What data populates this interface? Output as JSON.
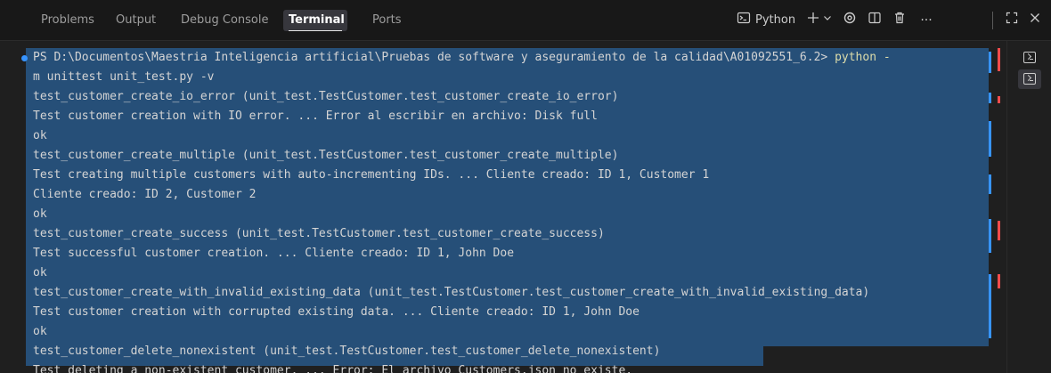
{
  "tabs": [
    {
      "label": "Problems",
      "active": false
    },
    {
      "label": "Output",
      "active": false
    },
    {
      "label": "Debug Console",
      "active": false
    },
    {
      "label": "Terminal",
      "active": true
    },
    {
      "label": "Ports",
      "active": false
    }
  ],
  "toolbar": {
    "shell_label": "Python",
    "icons": [
      "terminal-icon",
      "plus-icon",
      "chevron-down-icon",
      "copilot-icon",
      "split-icon",
      "trash-icon",
      "more-icon",
      "maximize-icon",
      "close-icon"
    ]
  },
  "terminal": {
    "lines": [
      {
        "text": "PS D:\\Documentos\\Maestria Inteligencia artificial\\Pruebas de software y aseguramiento de la calidad\\A01092551_6.2> ",
        "highlight": "python -"
      },
      {
        "text": "m unittest unit_test.py -v"
      },
      {
        "text": "test_customer_create_io_error (unit_test.TestCustomer.test_customer_create_io_error)"
      },
      {
        "text": "Test customer creation with IO error. ... Error al escribir en archivo: Disk full"
      },
      {
        "text": "ok"
      },
      {
        "text": "test_customer_create_multiple (unit_test.TestCustomer.test_customer_create_multiple)"
      },
      {
        "text": "Test creating multiple customers with auto-incrementing IDs. ... Cliente creado: ID 1, Customer 1"
      },
      {
        "text": "Cliente creado: ID 2, Customer 2"
      },
      {
        "text": "ok"
      },
      {
        "text": "test_customer_create_success (unit_test.TestCustomer.test_customer_create_success)"
      },
      {
        "text": "Test successful customer creation. ... Cliente creado: ID 1, John Doe"
      },
      {
        "text": "ok"
      },
      {
        "text": "test_customer_create_with_invalid_existing_data (unit_test.TestCustomer.test_customer_create_with_invalid_existing_data)"
      },
      {
        "text": "Test customer creation with corrupted existing data. ... Cliente creado: ID 1, John Doe"
      },
      {
        "text": "ok"
      },
      {
        "text": "test_customer_delete_nonexistent (unit_test.TestCustomer.test_customer_delete_nonexistent)"
      },
      {
        "text": "Test deleting a non-existent customer. ... Error: El archivo Customers.json no existe."
      }
    ]
  },
  "side_terminals": [
    "terminal-icon",
    "terminal-icon"
  ],
  "colors": {
    "selection": "#264f78",
    "background": "#1f1f1f",
    "highlight_text": "#dcdcaa",
    "ruler_blue": "#3794ff",
    "ruler_red": "#f14c4c"
  }
}
